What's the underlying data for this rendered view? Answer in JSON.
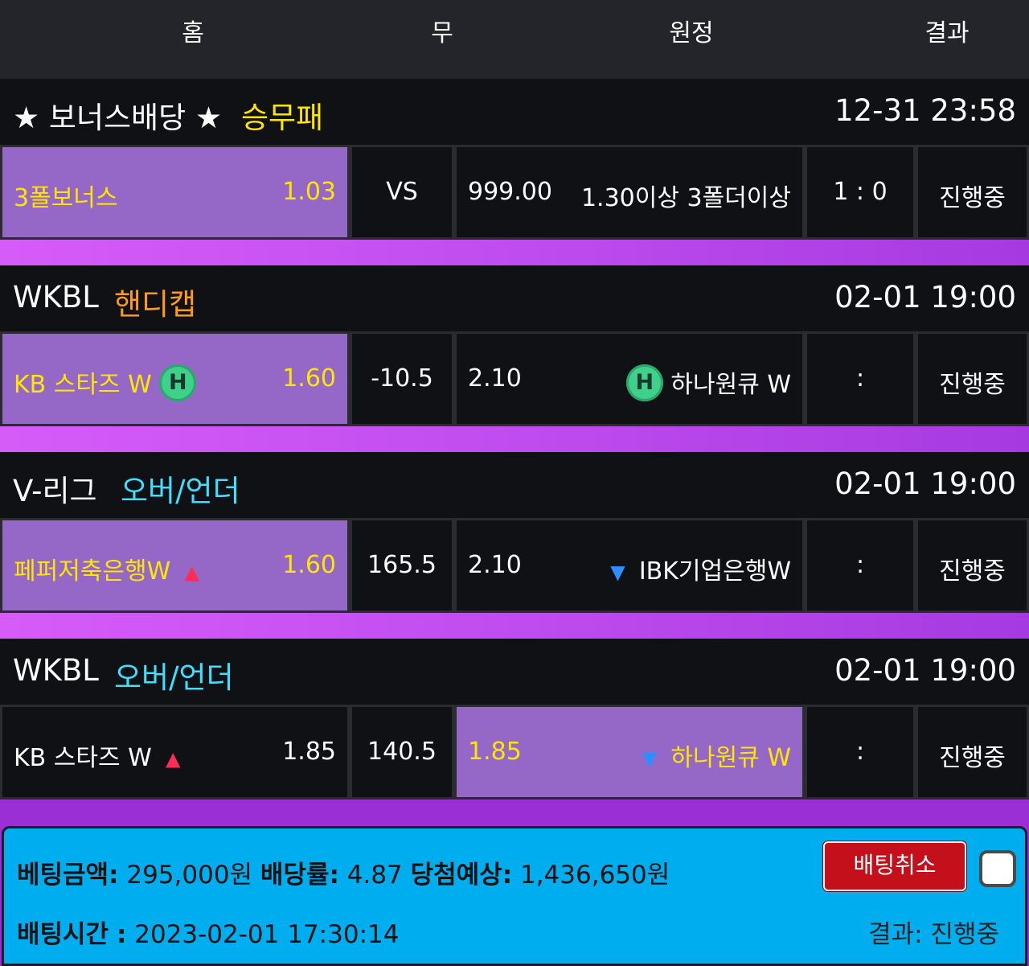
{
  "header": {
    "home": "홈",
    "draw": "무",
    "away": "원정",
    "result": "결과"
  },
  "groups": [
    {
      "league": "★ 보너스배당 ★",
      "bet_type": "승무패",
      "bet_type_color": "#ffe600",
      "time": "12-31 23:58",
      "home_name": "3폴보너스",
      "home_odds": "1.03",
      "middle": "VS",
      "away_odds": "999.00",
      "away_name": "1.30이상 3폴더이상",
      "score": "1 : 0",
      "status": "진행중",
      "selected": "home"
    },
    {
      "league": "WKBL",
      "bet_type": "핸디캡",
      "bet_type_color": "#ff9a1a",
      "time": "02-01 19:00",
      "home_name": "KB 스타즈 W",
      "home_badge": "H",
      "home_odds": "1.60",
      "middle": "-10.5",
      "away_odds": "2.10",
      "away_badge": "H",
      "away_name": "하나원큐 W",
      "score": ":",
      "status": "진행중",
      "selected": "home"
    },
    {
      "league": "V-리그",
      "bet_type": "오버/언더",
      "bet_type_color": "#3ee0ff",
      "time": "02-01 19:00",
      "home_name": "페퍼저축은행W",
      "home_icon": "arrow-up-icon",
      "home_odds": "1.60",
      "middle": "165.5",
      "away_odds": "2.10",
      "away_icon": "arrow-down-icon",
      "away_name": "IBK기업은행W",
      "score": ":",
      "status": "진행중",
      "selected": "home"
    },
    {
      "league": "WKBL",
      "bet_type": "오버/언더",
      "bet_type_color": "#3ee0ff",
      "time": "02-01 19:00",
      "home_name": "KB 스타즈 W",
      "home_icon": "arrow-up-icon",
      "home_odds": "1.85",
      "middle": "140.5",
      "away_odds": "1.85",
      "away_icon": "arrow-down-icon",
      "away_name": "하나원큐 W",
      "score": ":",
      "status": "진행중",
      "selected": "away"
    }
  ],
  "footer": {
    "bet_amount_label": "베팅금액:",
    "bet_amount": "295,000원",
    "odds_label": "배당률:",
    "odds": "4.87",
    "expected_label": "당첨예상:",
    "expected": "1,436,650원",
    "time_label": "배팅시간",
    "time_sep": ":",
    "bet_time": "2023-02-01 17:30:14",
    "cancel_button": "배팅취소",
    "result_label": "결과:",
    "result_value": "진행중"
  },
  "colors": {
    "selected_bg": "#9567c6",
    "selected_text": "#ffe600",
    "footer_bg": "#00aef0",
    "cancel_bg": "#c3101a"
  }
}
